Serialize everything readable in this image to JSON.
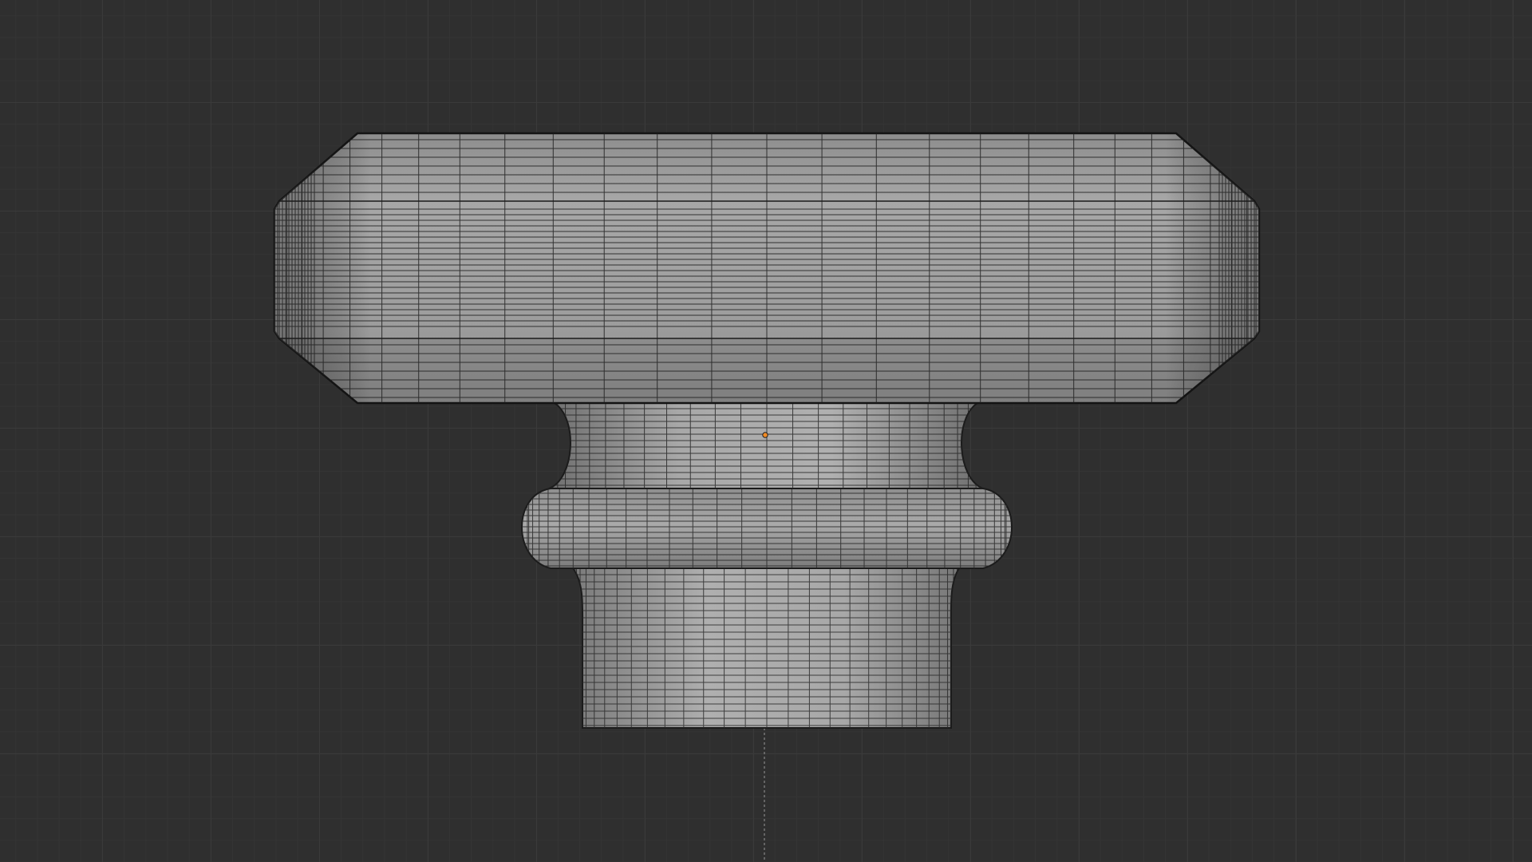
{
  "viewport": {
    "background_color": "#2f2f2f",
    "grid_major_color": "#3a3a3a",
    "grid_minor_color": "#343434"
  },
  "object": {
    "kind": "mesh-wireframe-shaded",
    "name_icon": "cabinet-knob-mesh",
    "surface_color": "#a5a5a5",
    "wire_color": "#1a1a1a",
    "origin_color": "#f08a24"
  }
}
